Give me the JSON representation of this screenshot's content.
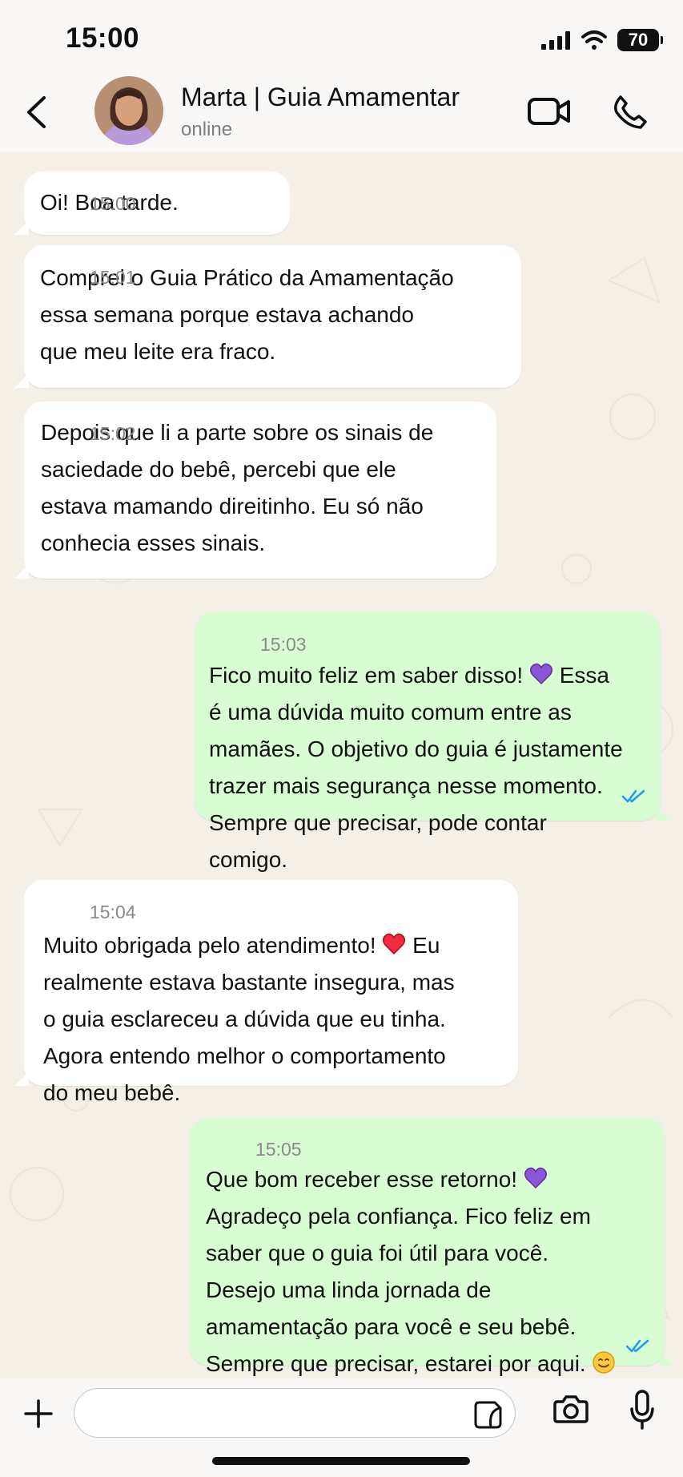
{
  "status_bar": {
    "time": "15:00",
    "battery": "70"
  },
  "contact": {
    "name": "Marta | Guia Amamentar",
    "status": "online"
  },
  "messages": [
    {
      "direction": "incoming",
      "text": "Oi! Boa tarde.",
      "time": "15:00"
    },
    {
      "direction": "incoming",
      "text": "Comprei o Guia Prático da Amamentação\nessa semana porque estava achando\nque meu leite era fraco.",
      "time": "15:01"
    },
    {
      "direction": "incoming",
      "text": "Depois que li a parte sobre os sinais de\nsaciedade do bebê, percebi que ele\nestava mamando direitinho. Eu só não\nconhecia esses sinais.",
      "time": "15:02"
    },
    {
      "direction": "outgoing",
      "text_before": "Fico muito feliz em saber disso! ",
      "emoji": "purple-heart",
      "text_after": " Essa\né uma dúvida muito comum entre as\nmamães. O objetivo do guia é justamente\ntrazer mais segurança nesse momento.\nSempre que precisar, pode contar\ncomigo.",
      "time": "15:03",
      "read": true
    },
    {
      "direction": "incoming",
      "text_before": "Muito obrigada pelo atendimento! ",
      "emoji": "red-heart",
      "text_after": " Eu\nrealmente estava bastante insegura, mas\no guia esclareceu a dúvida que eu tinha.\nAgora entendo melhor o comportamento\ndo meu bebê.",
      "time": "15:04"
    },
    {
      "direction": "outgoing",
      "text_before": "Que bom receber esse retorno! ",
      "emoji": "purple-heart",
      "text_after": "\nAgradeço pela confiança. Fico feliz em\nsaber que o guia foi útil para você.\nDesejo uma linda jornada de\namamentação para você e seu bebê.\nSempre que precisar, estarei por aqui. ",
      "emoji_end": "smiling-face",
      "time": "15:05",
      "read": true
    }
  ],
  "composer": {
    "placeholder": ""
  },
  "colors": {
    "background": "#f4efe7",
    "header": "#f8f7f5",
    "incoming": "#ffffff",
    "outgoing": "#d9fdd3",
    "read_tick": "#1d9bf0"
  }
}
